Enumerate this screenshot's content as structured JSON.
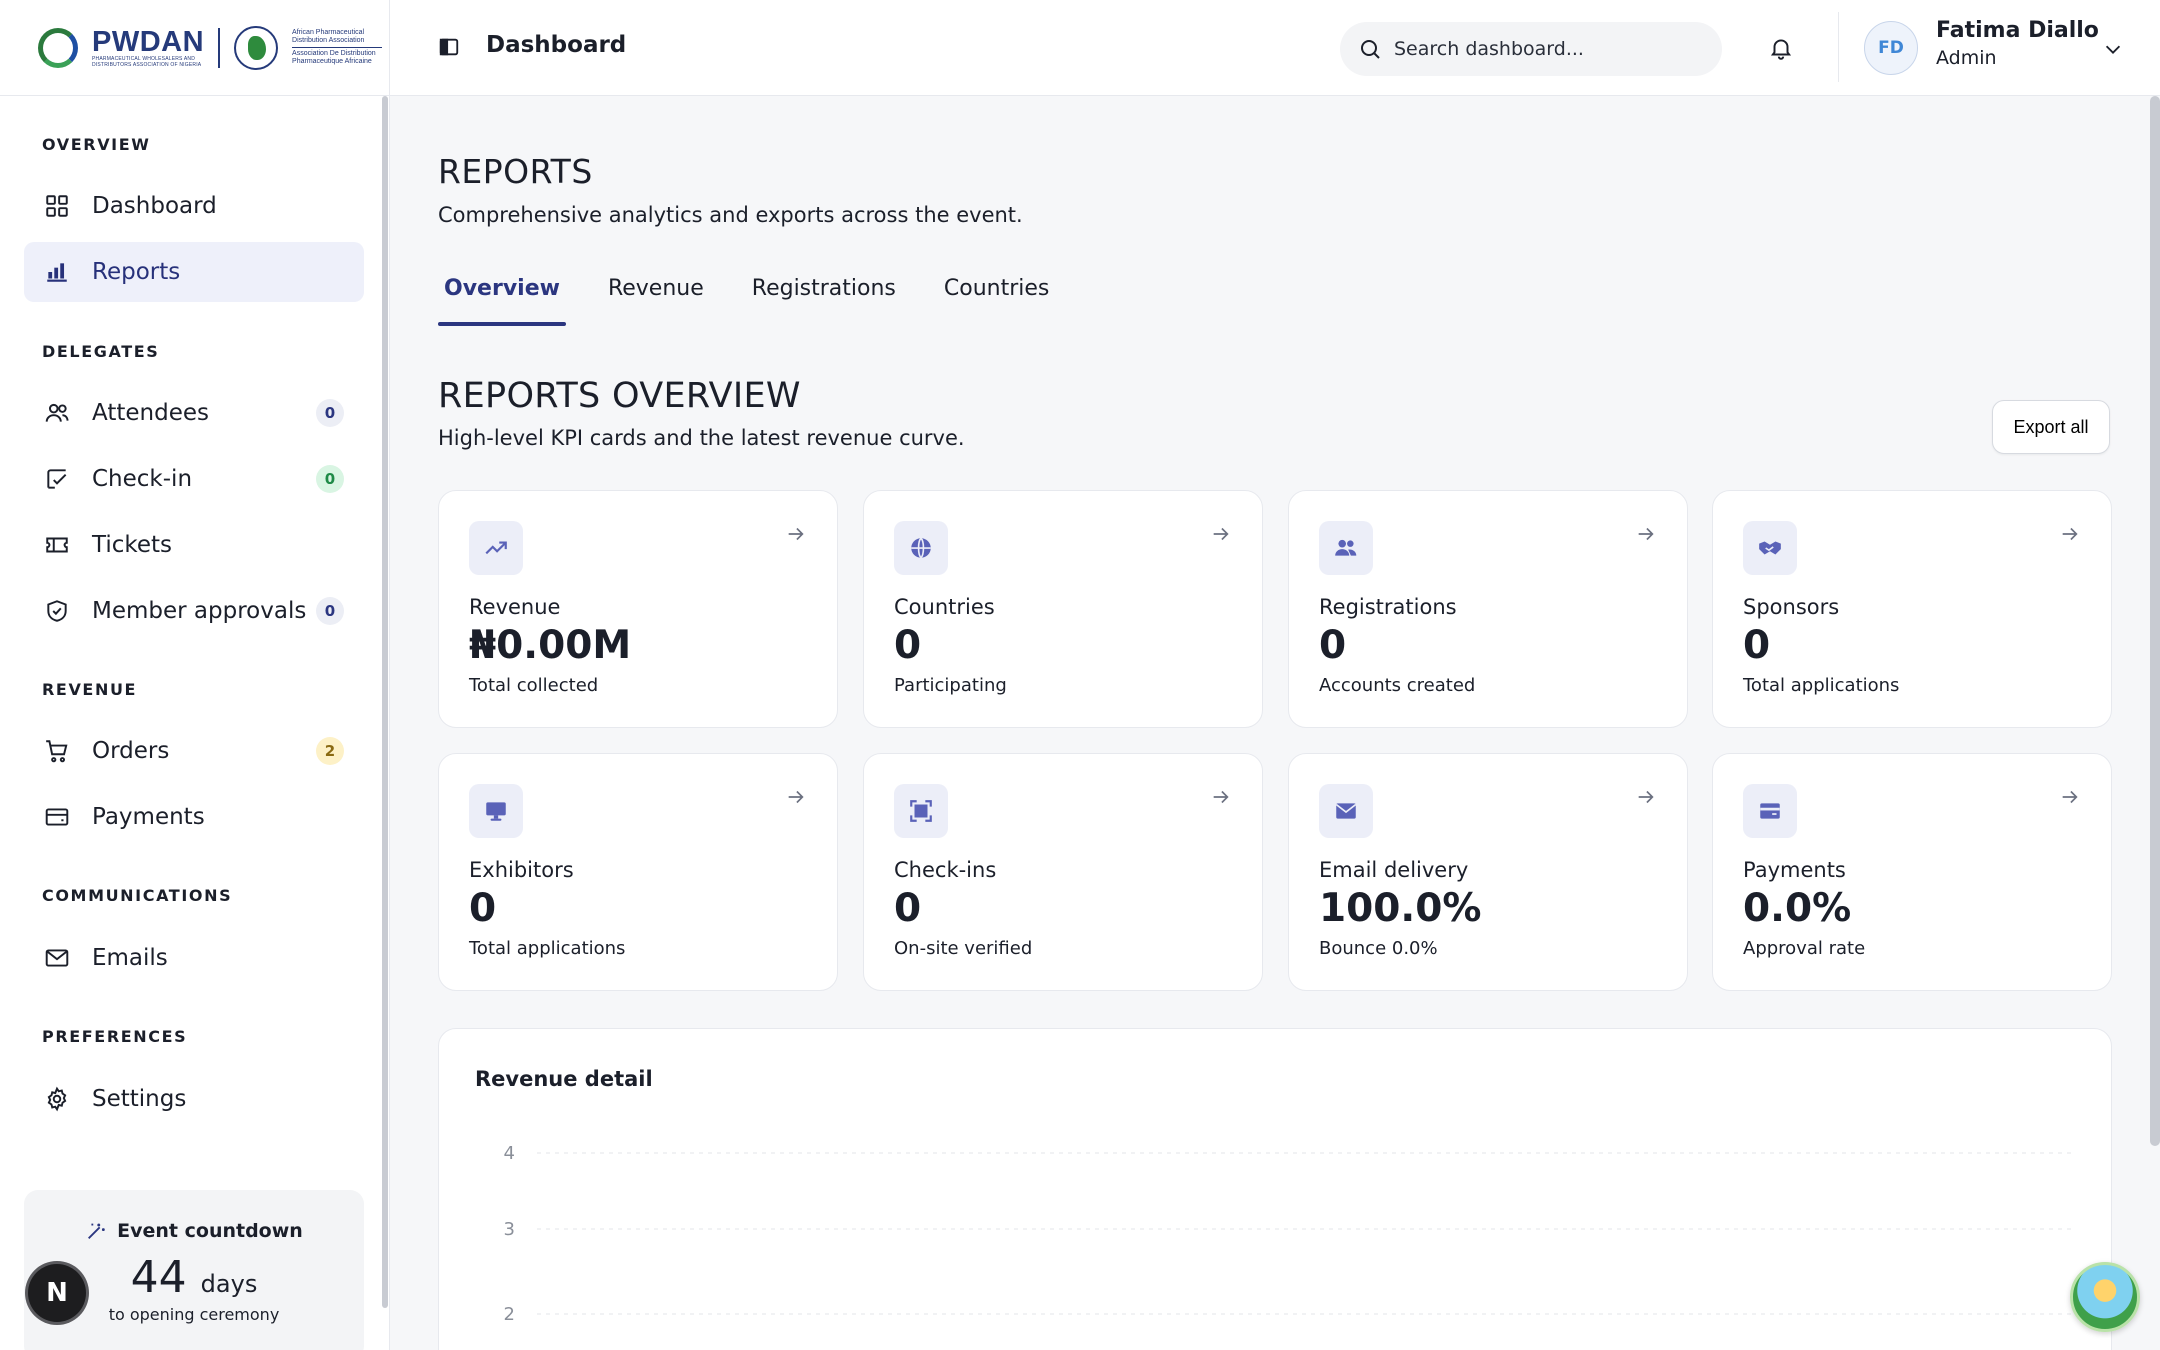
{
  "brand": {
    "primary": "#2b3680",
    "accent_green": "#1f8a47"
  },
  "logo": {
    "name": "PWDAN",
    "tagline": "PHARMACEUTICAL WHOLESALERS AND DISTRIBUTORS ASSOCIATION OF NIGERIA",
    "partner_line1": "African Pharmaceutical Distribution Association",
    "partner_line2": "Association De Distribution Pharmaceutique Africaine"
  },
  "topbar": {
    "title": "Dashboard",
    "search_placeholder": "Search dashboard...",
    "user_initials": "FD",
    "user_name": "Fatima Diallo",
    "user_role": "Admin"
  },
  "sidebar": {
    "sections": {
      "overview": "OVERVIEW",
      "delegates": "DELEGATES",
      "revenue": "REVENUE",
      "communications": "COMMUNICATIONS",
      "preferences": "PREFERENCES"
    },
    "items": {
      "dashboard": "Dashboard",
      "reports": "Reports",
      "attendees": "Attendees",
      "attendees_count": "0",
      "checkin": "Check-in",
      "checkin_count": "0",
      "tickets": "Tickets",
      "approvals": "Member approvals",
      "approvals_count": "0",
      "orders": "Orders",
      "orders_count": "2",
      "payments": "Payments",
      "emails": "Emails",
      "settings": "Settings"
    },
    "countdown": {
      "title": "Event countdown",
      "days": "44",
      "unit": "days",
      "caption": "to opening ceremony"
    },
    "n_badge": "N"
  },
  "page": {
    "title": "REPORTS",
    "subtitle": "Comprehensive analytics and exports across the event.",
    "tabs": [
      "Overview",
      "Revenue",
      "Registrations",
      "Countries"
    ],
    "section_title": "REPORTS OVERVIEW",
    "section_subtitle": "High-level KPI cards and the latest revenue curve.",
    "export_label": "Export all"
  },
  "kpis": [
    {
      "label": "Revenue",
      "value": "₦0.00M",
      "caption": "Total collected",
      "icon": "trending-up-icon"
    },
    {
      "label": "Countries",
      "value": "0",
      "caption": "Participating",
      "icon": "globe-icon"
    },
    {
      "label": "Registrations",
      "value": "0",
      "caption": "Accounts created",
      "icon": "users-icon"
    },
    {
      "label": "Sponsors",
      "value": "0",
      "caption": "Total applications",
      "icon": "handshake-icon"
    },
    {
      "label": "Exhibitors",
      "value": "0",
      "caption": "Total applications",
      "icon": "monitor-icon"
    },
    {
      "label": "Check-ins",
      "value": "0",
      "caption": "On-site verified",
      "icon": "scan-icon"
    },
    {
      "label": "Email delivery",
      "value": "100.0%",
      "caption": "Bounce 0.0%",
      "icon": "mail-icon"
    },
    {
      "label": "Payments",
      "value": "0.0%",
      "caption": "Approval rate",
      "icon": "credit-card-icon"
    }
  ],
  "revenue_detail": {
    "title": "Revenue detail",
    "y_ticks": [
      "4",
      "3",
      "2"
    ]
  }
}
